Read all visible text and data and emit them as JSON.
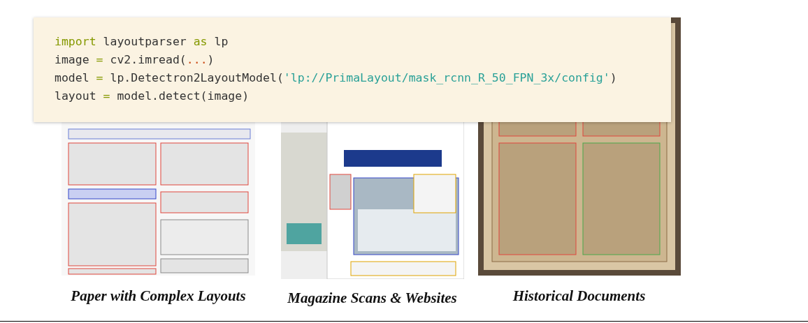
{
  "code_block": {
    "lines": [
      [
        {
          "text": "import",
          "kind": "keyword"
        },
        {
          "text": " layoutparser ",
          "kind": "plain"
        },
        {
          "text": "as",
          "kind": "keyword"
        },
        {
          "text": " lp",
          "kind": "plain"
        }
      ],
      [
        {
          "text": "image ",
          "kind": "plain"
        },
        {
          "text": "=",
          "kind": "keyword"
        },
        {
          "text": " cv2.imread(",
          "kind": "plain"
        },
        {
          "text": "...",
          "kind": "literal"
        },
        {
          "text": ")",
          "kind": "plain"
        }
      ],
      [
        {
          "text": "model ",
          "kind": "plain"
        },
        {
          "text": "=",
          "kind": "keyword"
        },
        {
          "text": " lp.Detectron2LayoutModel(",
          "kind": "plain"
        },
        {
          "text": "'lp://PrimaLayout/mask_rcnn_R_50_FPN_3x/config'",
          "kind": "string"
        },
        {
          "text": ")",
          "kind": "plain"
        }
      ],
      [
        {
          "text": "layout ",
          "kind": "plain"
        },
        {
          "text": "=",
          "kind": "keyword"
        },
        {
          "text": " model.detect(image)",
          "kind": "plain"
        }
      ]
    ]
  },
  "examples": [
    {
      "kind": "paper",
      "caption": "Paper with Complex Layouts"
    },
    {
      "kind": "magazine",
      "caption": "Magazine Scans & Websites"
    },
    {
      "kind": "historical",
      "caption": "Historical Documents"
    }
  ]
}
